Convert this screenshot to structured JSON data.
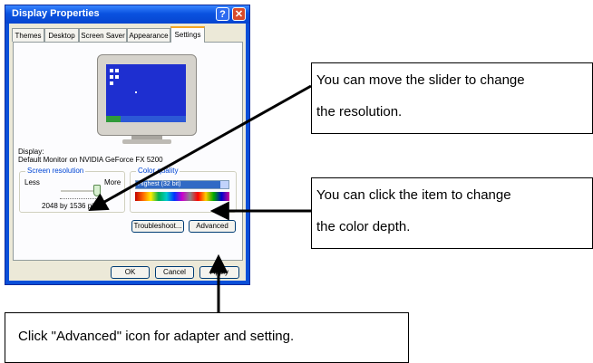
{
  "window": {
    "title": "Display Properties",
    "help_glyph": "?",
    "close_glyph": "✕"
  },
  "tabs": [
    {
      "label": "Themes",
      "active": false
    },
    {
      "label": "Desktop",
      "active": false
    },
    {
      "label": "Screen Saver",
      "active": false
    },
    {
      "label": "Appearance",
      "active": false
    },
    {
      "label": "Settings",
      "active": true
    }
  ],
  "display": {
    "label": "Display:",
    "value": "Default Monitor on NVIDIA GeForce FX 5200"
  },
  "screen_resolution": {
    "label": "Screen resolution",
    "less_label": "Less",
    "more_label": "More",
    "value_text": "2048 by 1536 pixels",
    "slider_fraction": 1.0
  },
  "color_quality": {
    "label": "Color quality",
    "selected": "Highest (32 bit)"
  },
  "buttons": {
    "troubleshoot": "Troubleshoot...",
    "advanced": "Advanced",
    "ok": "OK",
    "cancel": "Cancel",
    "apply": "Apply"
  },
  "callouts": {
    "slider": [
      "You can move the slider to change",
      "the resolution."
    ],
    "color": [
      "You can click the item to change",
      "the color depth."
    ],
    "advanced": "Click \"Advanced\" icon for adapter and setting."
  },
  "colors": {
    "titlebar": "#0a52e0",
    "close_button": "#d94a2a",
    "dialog_face": "#ece9d8",
    "selection": "#316ac5"
  }
}
